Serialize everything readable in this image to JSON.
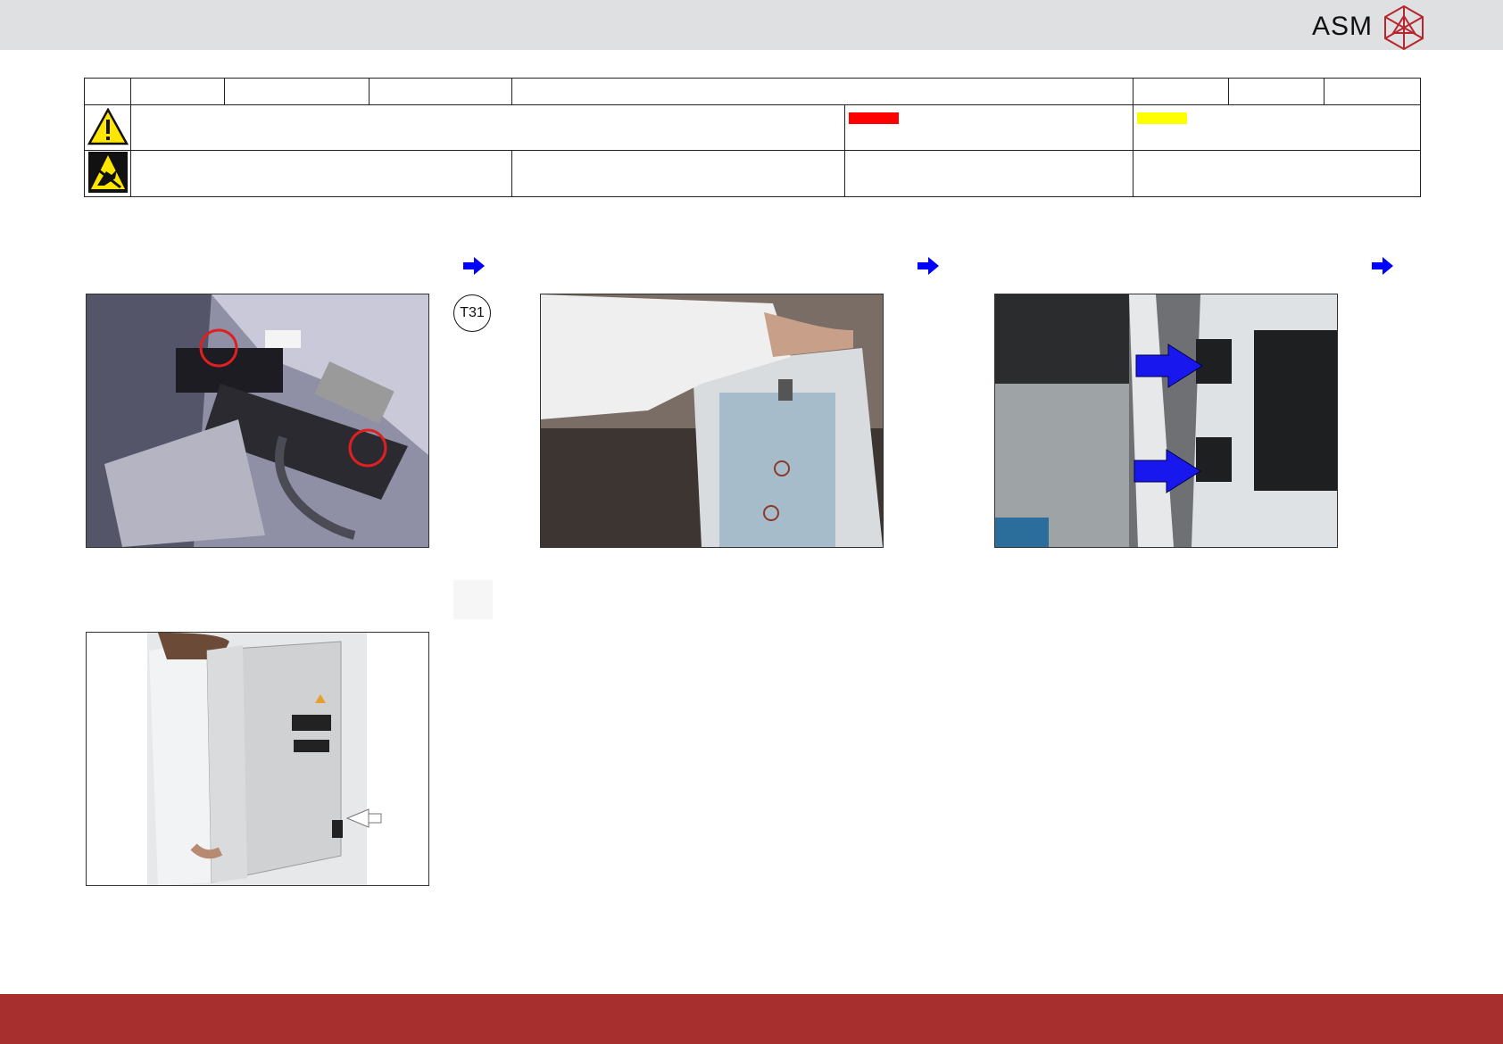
{
  "header": {
    "brand": "ASM",
    "logo_icon": "asm-cube-logo",
    "accent_color": "#a72f2e"
  },
  "table": {
    "row1_cells": [
      "",
      "",
      "",
      "",
      "",
      "",
      "",
      ""
    ],
    "warning_icon": "warning-triangle-icon",
    "esd_icon": "esd-hand-icon",
    "danger_swatch_color": "#ff0000",
    "caution_swatch_color": "#ffff00"
  },
  "steps": {
    "step_badge": "T31",
    "arrow_icon": "blue-arrow-right-icon",
    "arrow_color": "#0000ff"
  },
  "images": {
    "photo1": "machine-interior-screws-photo",
    "photo2": "operator-lifting-cover-photo",
    "photo3": "mounting-points-photo",
    "photo4": "operator-carrying-module-photo"
  },
  "footer": {
    "color": "#a72f2e"
  }
}
